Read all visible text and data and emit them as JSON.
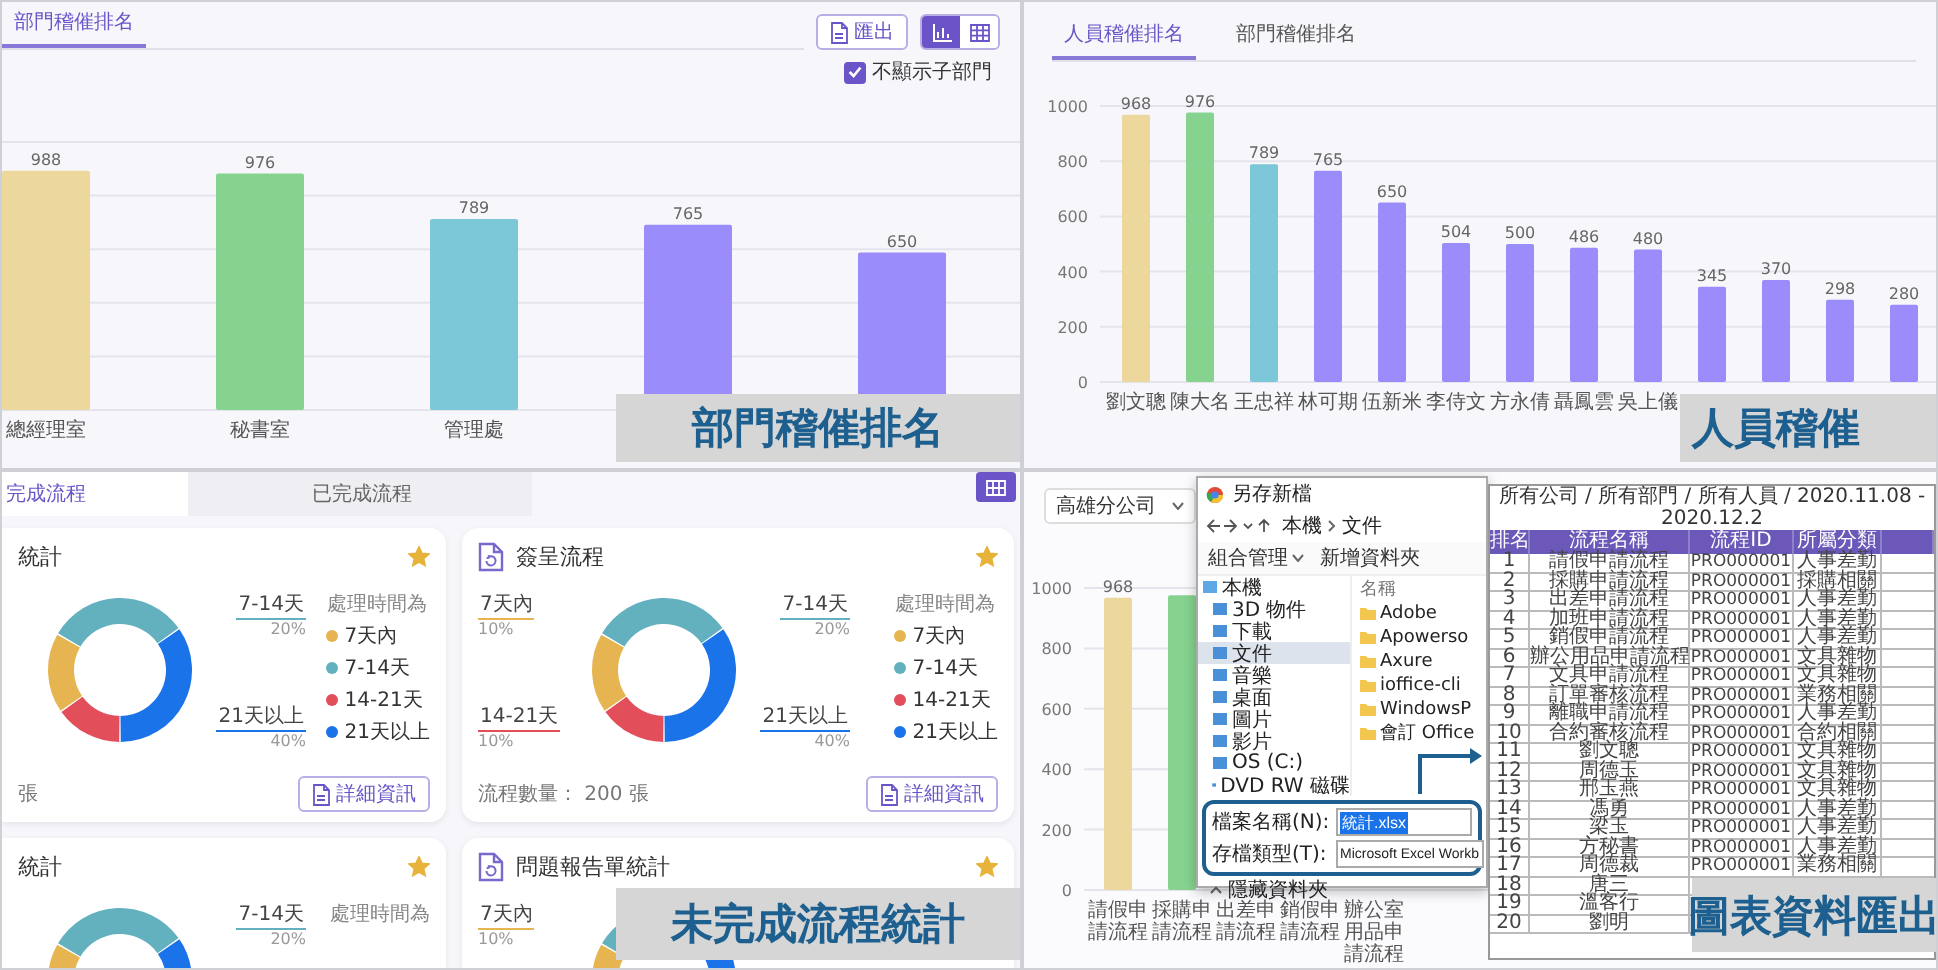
{
  "department_ranking": {
    "tabs": [
      {
        "label": "部門稽催排名",
        "selected": true
      }
    ],
    "export_button": "匯出",
    "view_toggle": [
      {
        "kind": "chart",
        "selected": true
      },
      {
        "kind": "table",
        "selected": false
      }
    ],
    "hide_subdepartments": {
      "label": "不顯示子部門",
      "checked": true
    },
    "chart_data": {
      "type": "bar",
      "grid": true,
      "categories": [
        "總經理室",
        "秘書室",
        "管理處",
        null,
        null
      ],
      "series": [
        {
          "values": [
            988,
            976,
            789,
            765,
            650
          ]
        }
      ],
      "colors": [
        "#ecd89c",
        "#86d38f",
        "#7cc8d8",
        "#9b8cfb",
        "#9b8cfb"
      ],
      "data_labels": true
    },
    "caption": "部門稽催排名"
  },
  "staff_ranking": {
    "tabs": [
      {
        "label": "人員稽催排名",
        "selected": true
      },
      {
        "label": "部門稽催排名",
        "selected": false
      }
    ],
    "chart_data": {
      "type": "bar",
      "grid": true,
      "categories": [
        "劉文聰",
        "陳大名",
        "王忠祥",
        "林可期",
        "伍新米",
        "李侍文",
        "方永倩",
        "聶鳳雲",
        "吳上儀",
        null,
        null,
        null,
        null
      ],
      "series": [
        {
          "values": [
            968,
            976,
            789,
            765,
            650,
            504,
            500,
            486,
            480,
            345,
            370,
            298,
            280
          ]
        }
      ],
      "colors": [
        "#ecd89c",
        "#86d38f",
        "#7cc8d8",
        "#9b8cfb",
        "#9b8cfb",
        "#9b8cfb",
        "#9b8cfb",
        "#9b8cfb",
        "#9b8cfb",
        "#9b8cfb",
        "#9b8cfb",
        "#9b8cfb",
        "#9b8cfb"
      ],
      "ylim": [
        0,
        1000
      ],
      "yticks": [
        0,
        200,
        400,
        600,
        800,
        1000
      ],
      "data_labels": true
    },
    "caption": "人員稽催"
  },
  "pending_flow_stats": {
    "tabs": [
      {
        "label": "完成流程",
        "selected": true
      },
      {
        "label": "已完成流程",
        "selected": false
      }
    ],
    "cards": [
      {
        "title": "統計",
        "icon": false,
        "starred": true,
        "segments": [
          {
            "kind": "left",
            "color": "#e6b552"
          },
          {
            "kind": "top",
            "color": "#63b1bf"
          },
          {
            "kind": "bottom",
            "color": "#e24f5a"
          },
          {
            "kind": "right",
            "color": "#1a73e8"
          }
        ],
        "right_callouts": [
          {
            "label": "7-14天",
            "share": "20%",
            "color": "#63b1bf"
          },
          {
            "label": "21天以上",
            "share": "40%",
            "color": "#1a73e8"
          }
        ],
        "legend_title": "處理時間為",
        "legend": [
          {
            "label": "7天內",
            "color": "#e6b552"
          },
          {
            "label": "7-14天",
            "color": "#63b1bf"
          },
          {
            "label": "14-21天",
            "color": "#e24f5a"
          },
          {
            "label": "21天以上",
            "color": "#1a73e8"
          }
        ],
        "count": "張",
        "details_button": "詳細資訊"
      },
      {
        "title": "簽呈流程",
        "icon": true,
        "starred": true,
        "segments": [
          {
            "kind": "left",
            "color": "#e6b552"
          },
          {
            "kind": "top",
            "color": "#63b1bf"
          },
          {
            "kind": "bottom",
            "color": "#e24f5a"
          },
          {
            "kind": "right",
            "color": "#1a73e8"
          }
        ],
        "left_callouts": [
          {
            "label": "7天內",
            "share": "10%",
            "color": "#e6b552"
          },
          {
            "label": "14-21天",
            "share": "10%",
            "color": "#e24f5a"
          }
        ],
        "right_callouts": [
          {
            "label": "7-14天",
            "share": "20%",
            "color": "#63b1bf"
          },
          {
            "label": "21天以上",
            "share": "40%",
            "color": "#1a73e8"
          }
        ],
        "legend_title": "處理時間為",
        "legend": [
          {
            "label": "7天內",
            "color": "#e6b552"
          },
          {
            "label": "7-14天",
            "color": "#63b1bf"
          },
          {
            "label": "14-21天",
            "color": "#e24f5a"
          },
          {
            "label": "21天以上",
            "color": "#1a73e8"
          }
        ],
        "count": "流程數量： 200 張",
        "details_button": "詳細資訊"
      },
      {
        "title": "統計",
        "icon": false,
        "starred": true,
        "segments": [
          {
            "kind": "left",
            "color": "#e6b552"
          },
          {
            "kind": "top",
            "color": "#63b1bf"
          },
          {
            "kind": "right",
            "color": "#1a73e8"
          }
        ],
        "right_callouts": [
          {
            "label": "7-14天",
            "share": "20%",
            "color": "#63b1bf"
          }
        ],
        "legend_title": "處理時間為"
      },
      {
        "title": "問題報告單統計",
        "icon": true,
        "starred": true,
        "segments": [
          {
            "kind": "left",
            "color": "#e6b552"
          },
          {
            "kind": "top",
            "color": "#63b1bf"
          },
          {
            "kind": "right",
            "color": "#1a73e8"
          }
        ],
        "left_callouts": [
          {
            "label": "7天內",
            "share": "10%",
            "color": "#e6b552"
          }
        ]
      }
    ],
    "caption": "未完成流程統計"
  },
  "chart_export": {
    "company_select": "高雄分公司",
    "chart_data": {
      "type": "bar",
      "grid": true,
      "categories": [
        "請假申請流程",
        "採購申請流程",
        "出差申請流程",
        "銷假申請流程",
        "辦公室用品申請流程"
      ],
      "series": [
        {
          "values": [
            968,
            976,
            null,
            null,
            null
          ]
        }
      ],
      "colors": [
        "#ecd89c",
        "#86d38f"
      ],
      "ylim": [
        0,
        1000
      ],
      "yticks": [
        0,
        200,
        400,
        600,
        800,
        1000
      ],
      "value_labels": [
        "968",
        null,
        null,
        null,
        null
      ]
    },
    "save_dialog": {
      "title": "另存新檔",
      "path": [
        "本機",
        "文件"
      ],
      "toolbar": [
        "組合管理",
        "新增資料夾"
      ],
      "tree": [
        {
          "label": "本機",
          "selected": false,
          "children": [
            {
              "label": "3D 物件",
              "selected": false
            },
            {
              "label": "下載",
              "selected": false
            },
            {
              "label": "文件",
              "selected": true
            },
            {
              "label": "音樂",
              "selected": false
            },
            {
              "label": "桌面",
              "selected": false
            },
            {
              "label": "圖片",
              "selected": false
            },
            {
              "label": "影片",
              "selected": false
            },
            {
              "label": "OS (C:)",
              "selected": false
            },
            {
              "label": "DVD RW 磁碟",
              "selected": false
            }
          ]
        }
      ],
      "list_header": "名稱",
      "files": [
        "Adobe",
        "Apowerso",
        "Axure",
        "ioffice-cli",
        "WindowsP",
        "會訂 Office"
      ],
      "filename_label": "檔案名稱(N):",
      "filename": "統計.xlsx",
      "type_label": "存檔類型(T):",
      "file_type": "Microsoft Excel Workb",
      "hide_folders": "隱藏資料夾"
    },
    "table": {
      "title": "所有公司 / 所有部門 / 所有人員 / 2020.11.08 - 2020.12.2",
      "columns": [
        "排名",
        "流程名稱",
        "流程ID",
        "所屬分類"
      ],
      "rows": [
        {
          "cells": [
            "1",
            "請假申請流程",
            "PRO000001",
            "人事差勤"
          ]
        },
        {
          "cells": [
            "2",
            "採購申請流程",
            "PRO000001",
            "採購相關"
          ]
        },
        {
          "cells": [
            "3",
            "出差申請流程",
            "PRO000001",
            "人事差勤"
          ]
        },
        {
          "cells": [
            "4",
            "加班申請流程",
            "PRO000001",
            "人事差勤"
          ]
        },
        {
          "cells": [
            "5",
            "銷假申請流程",
            "PRO000001",
            "人事差勤"
          ]
        },
        {
          "cells": [
            "6",
            "辦公用品申請流程",
            "PRO000001",
            "文具雜物"
          ]
        },
        {
          "cells": [
            "7",
            "文具申請流程",
            "PRO000001",
            "文具雜物"
          ]
        },
        {
          "cells": [
            "8",
            "訂單審核流程",
            "PRO000001",
            "業務相關"
          ]
        },
        {
          "cells": [
            "9",
            "離職申請流程",
            "PRO000001",
            "人事差勤"
          ]
        },
        {
          "cells": [
            "10",
            "合約審核流程",
            "PRO000001",
            "合約相關"
          ]
        },
        {
          "cells": [
            "11",
            "劉文聰",
            "PRO000001",
            "文具雜物"
          ]
        },
        {
          "cells": [
            "12",
            "周德玉",
            "PRO000001",
            "文具雜物"
          ]
        },
        {
          "cells": [
            "13",
            "邢玉燕",
            "PRO000001",
            "文具雜物"
          ]
        },
        {
          "cells": [
            "14",
            "馮勇",
            "PRO000001",
            "人事差勤"
          ]
        },
        {
          "cells": [
            "15",
            "梁玉",
            "PRO000001",
            "人事差勤"
          ]
        },
        {
          "cells": [
            "16",
            "方秘書",
            "PRO000001",
            "人事差勤"
          ]
        },
        {
          "cells": [
            "17",
            "周德裁",
            "PRO000001",
            "業務相關"
          ]
        },
        {
          "cells": [
            "18",
            "唐三"
          ]
        },
        {
          "cells": [
            "19",
            "溫客行"
          ]
        },
        {
          "cells": [
            "20",
            "劉明"
          ]
        }
      ]
    },
    "caption": "圖表資料匯出"
  }
}
